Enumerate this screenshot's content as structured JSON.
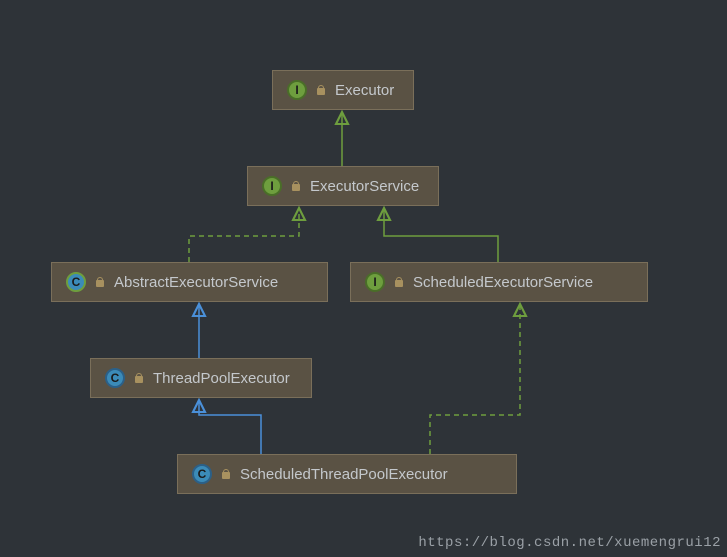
{
  "nodes": {
    "executor": {
      "type": "interface",
      "label": "Executor"
    },
    "executorService": {
      "type": "interface",
      "label": "ExecutorService"
    },
    "abstractExecutorService": {
      "type": "class-abstract",
      "label": "AbstractExecutorService"
    },
    "scheduledExecutorService": {
      "type": "interface",
      "label": "ScheduledExecutorService"
    },
    "threadPoolExecutor": {
      "type": "class",
      "label": "ThreadPoolExecutor"
    },
    "scheduledThreadPoolExecutor": {
      "type": "class",
      "label": "ScheduledThreadPoolExecutor"
    }
  },
  "edges": [
    {
      "from": "executorService",
      "to": "executor",
      "type": "extends-interface"
    },
    {
      "from": "abstractExecutorService",
      "to": "executorService",
      "type": "implements"
    },
    {
      "from": "scheduledExecutorService",
      "to": "executorService",
      "type": "extends-interface"
    },
    {
      "from": "threadPoolExecutor",
      "to": "abstractExecutorService",
      "type": "extends-class"
    },
    {
      "from": "scheduledThreadPoolExecutor",
      "to": "threadPoolExecutor",
      "type": "extends-class"
    },
    {
      "from": "scheduledThreadPoolExecutor",
      "to": "scheduledExecutorService",
      "type": "implements"
    }
  ],
  "watermark": "https://blog.csdn.net/xuemengrui12",
  "colors": {
    "background": "#2e3338",
    "boxFill": "#5a5244",
    "interfaceBadge": "#6e9e3e",
    "classBadge": "#3b8bb8",
    "extendsClassArrow": "#4a90d9",
    "implementsArrow": "#6e9e3e"
  }
}
